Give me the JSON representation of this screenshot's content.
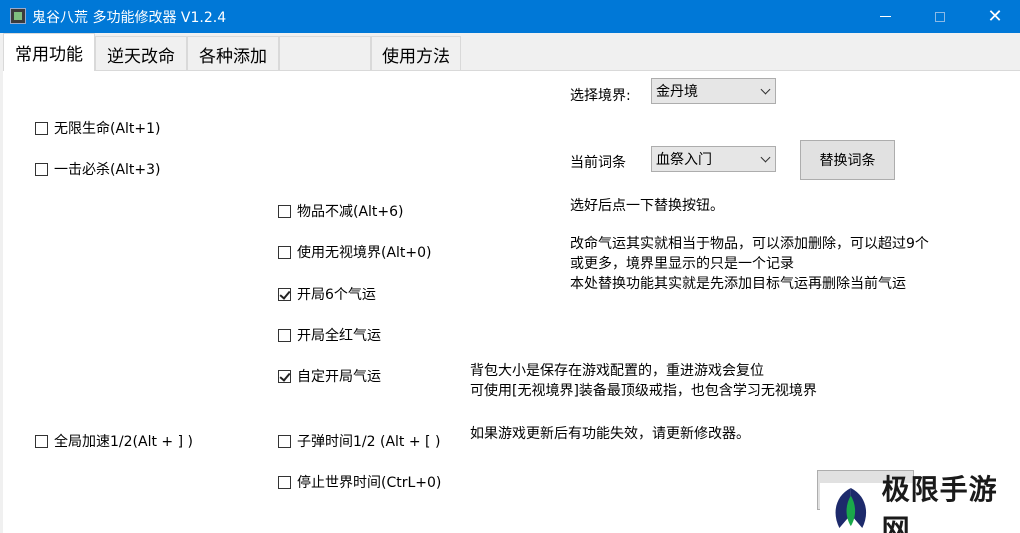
{
  "window": {
    "title": "鬼谷八荒 多功能修改器  V1.2.4",
    "minimize_glyph": "—",
    "close_glyph": "✕"
  },
  "tabs": [
    {
      "label": "常用功能",
      "active": true
    },
    {
      "label": "逆天改命",
      "active": false
    },
    {
      "label": "各种添加",
      "active": false
    },
    {
      "label": "",
      "active": false
    },
    {
      "label": "使用方法",
      "active": false
    }
  ],
  "checkboxes": {
    "infinite_life": {
      "label": "无限生命(Alt+1)",
      "checked": false
    },
    "one_hit_kill": {
      "label": "一击必杀(Alt+3)",
      "checked": false
    },
    "items_no_decrease": {
      "label": "物品不减(Alt+6)",
      "checked": false
    },
    "use_ignore_realm": {
      "label": "使用无视境界(Alt+0)",
      "checked": false
    },
    "start_6_fortune": {
      "label": "开局6个气运",
      "checked": true
    },
    "start_all_red_fortune": {
      "label": "开局全红气运",
      "checked": false
    },
    "custom_start_fortune": {
      "label": "自定开局气运",
      "checked": true
    },
    "global_speed_half": {
      "label": "全局加速1/2(Alt + ] )",
      "checked": false
    },
    "bullet_time_half": {
      "label": "子弹时间1/2 (Alt + [ )",
      "checked": false
    },
    "stop_world_time": {
      "label": "停止世界时间(CtrL+0)",
      "checked": false
    }
  },
  "realm": {
    "label": "选择境界:",
    "selected": "金丹境"
  },
  "entry": {
    "label": "当前词条",
    "selected": "血祭入门",
    "replace_button": "替换词条",
    "hint": "选好后点一下替换按钮。"
  },
  "notes": {
    "fortune_lines": [
      "改命气运其实就相当于物品，可以添加删除，可以超过9个",
      "或更多，境界里显示的只是一个记录",
      "本处替换功能其实就是先添加目标气运再删除当前气运"
    ],
    "bag_lines": [
      "背包大小是保存在游戏配置的，重进游戏会复位",
      "可使用[无视境界]装备最顶级戒指，也包含学习无视境界"
    ],
    "update_line": "如果游戏更新后有功能失效，请更新修改器。"
  },
  "bottom_button": "",
  "watermark": {
    "text": "极限手游网",
    "logo": "leaf-logo-icon",
    "colors": {
      "green": "#1aa84a",
      "navy": "#1d2a6b"
    }
  }
}
